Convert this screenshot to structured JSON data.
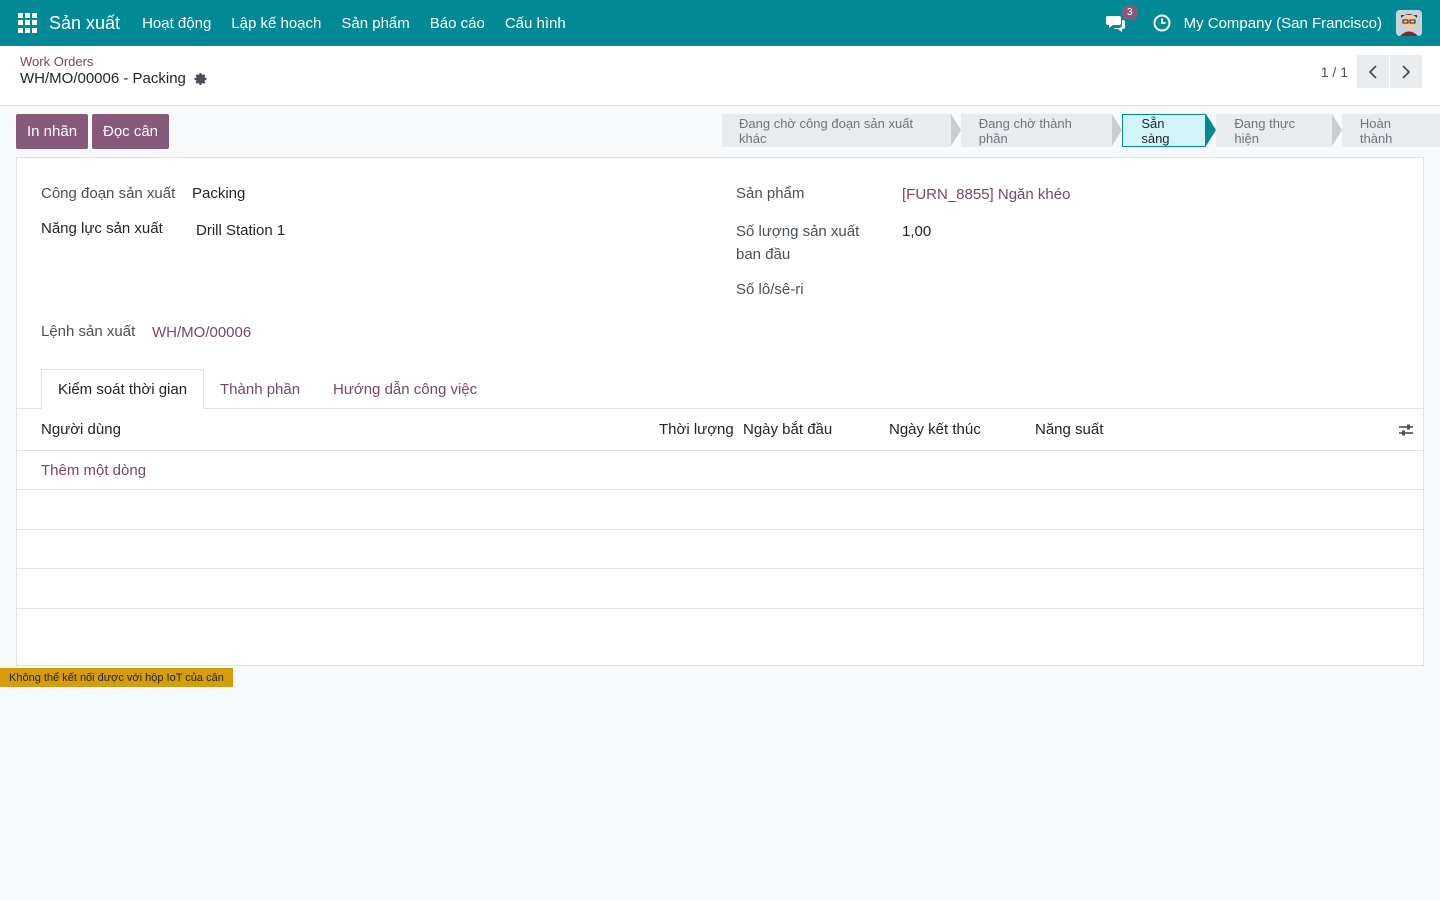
{
  "topbar": {
    "app_name": "Sản xuất",
    "menu": [
      "Hoạt động",
      "Lập kế hoạch",
      "Sản phẩm",
      "Báo cáo",
      "Cấu hình"
    ],
    "messages_count": "3",
    "company": "My Company (San Francisco)",
    "icons": [
      "apps-grid-icon",
      "chat-icon",
      "clock-icon",
      "avatar"
    ]
  },
  "control": {
    "breadcrumb": "Work Orders",
    "title": "WH/MO/00006 - Packing",
    "pager": "1 / 1"
  },
  "actions": {
    "print_label": "In nhãn",
    "read_scale": "Đọc cân"
  },
  "statusbar": {
    "steps": [
      "Đang chờ công đoạn sản xuất khác",
      "Đang chờ thành phần",
      "Sẵn sàng",
      "Đang thực hiện",
      "Hoàn thành"
    ],
    "active": "Sẵn sàng"
  },
  "form": {
    "operation_label": "Công đoạn sản xuất",
    "operation_value": "Packing",
    "workcenter_label": "Năng lực sản xuất",
    "workcenter_value": "Drill Station 1",
    "mo_label": "Lệnh sản xuất",
    "mo_value": "WH/MO/00006",
    "product_label": "Sản phẩm",
    "product_value": "[FURN_8855] Ngăn khéo",
    "qty_label_1": "Số lượng sản xuất",
    "qty_label_2": "ban đầu",
    "qty_value": "1,00",
    "lot_label": "Số lô/sê-ri"
  },
  "tabs": [
    "Kiểm soát thời gian",
    "Thành phần",
    "Hướng dẫn công việc"
  ],
  "table": {
    "headers": [
      "Người dùng",
      "Thời lượng",
      "Ngày bắt đầu",
      "Ngày kết thúc",
      "Năng suất"
    ],
    "add_line": "Thêm một dòng"
  },
  "iot_warning": "Không thể kết nối được với hộp IoT của cân",
  "colors": {
    "navbar": "#018a95",
    "primary_button": "#875a7b",
    "link": "#714b67",
    "status_active": "#d2f4f7",
    "warning": "#d59c0b"
  }
}
